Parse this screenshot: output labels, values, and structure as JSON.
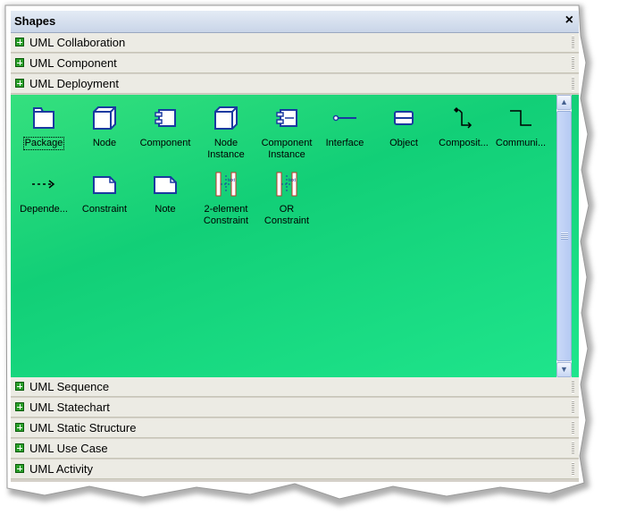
{
  "panel": {
    "title": "Shapes",
    "close_label": "×"
  },
  "categories_top": [
    {
      "label": "UML Collaboration"
    },
    {
      "label": "UML Component"
    },
    {
      "label": "UML Deployment"
    }
  ],
  "shapes": [
    {
      "label": "Package",
      "icon": "package-icon"
    },
    {
      "label": "Node",
      "icon": "node-icon"
    },
    {
      "label": "Component",
      "icon": "component-icon"
    },
    {
      "label": "Node\nInstance",
      "icon": "node-instance-icon"
    },
    {
      "label": "Component\nInstance",
      "icon": "component-instance-icon"
    },
    {
      "label": "Interface",
      "icon": "interface-icon"
    },
    {
      "label": "Object",
      "icon": "object-icon"
    },
    {
      "label": "Composit...",
      "icon": "composition-icon"
    },
    {
      "label": "Communi...",
      "icon": "communication-icon"
    },
    {
      "label": "Depende...",
      "icon": "dependency-icon"
    },
    {
      "label": "Constraint",
      "icon": "constraint-icon"
    },
    {
      "label": "Note",
      "icon": "note-icon"
    },
    {
      "label": "2-element\nConstraint",
      "icon": "two-element-constraint-icon"
    },
    {
      "label": "OR\nConstraint",
      "icon": "or-constraint-icon"
    }
  ],
  "constraint_icon_text": "text",
  "categories_bottom": [
    {
      "label": "UML Sequence"
    },
    {
      "label": "UML Statechart"
    },
    {
      "label": "UML Static Structure"
    },
    {
      "label": "UML Use Case"
    },
    {
      "label": "UML Activity"
    }
  ],
  "colors": {
    "stencil_background": "#1ed683",
    "icon_stroke": "#1a3aa0",
    "category_icon": "#2ba02b"
  },
  "selected_shape": "Package"
}
